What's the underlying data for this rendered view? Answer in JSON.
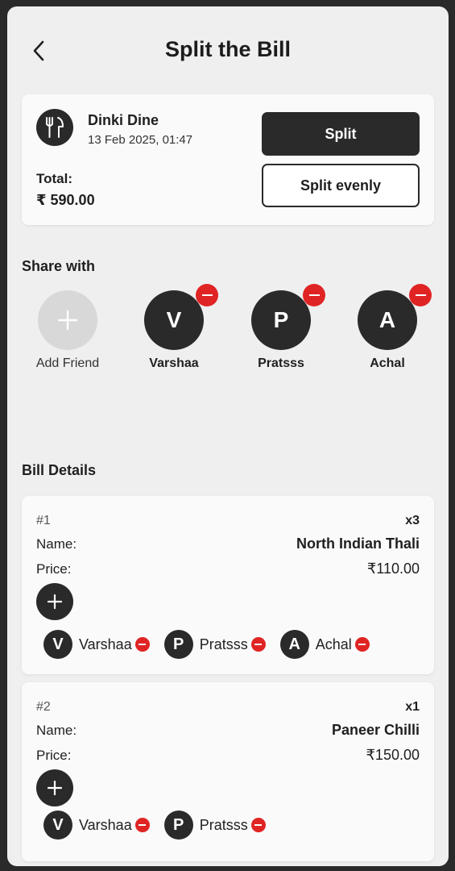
{
  "header": {
    "title": "Split the Bill"
  },
  "restaurant": {
    "name": "Dinki Dine",
    "date": "13 Feb 2025, 01:47",
    "total_label": "Total:",
    "total_value": "₹ 590.00",
    "icon": "fork-knife-icon"
  },
  "actions": {
    "split_label": "Split",
    "split_evenly_label": "Split evenly"
  },
  "share": {
    "label": "Share with",
    "add_label": "Add Friend",
    "friends": [
      {
        "initial": "V",
        "name": "Varshaa"
      },
      {
        "initial": "P",
        "name": "Pratsss"
      },
      {
        "initial": "A",
        "name": "Achal"
      }
    ]
  },
  "bill": {
    "label": "Bill Details",
    "name_label": "Name:",
    "price_label": "Price:",
    "items": [
      {
        "num": "#1",
        "qty": "x3",
        "name": "North Indian Thali",
        "price": "₹110.00",
        "people": [
          {
            "initial": "V",
            "name": "Varshaa"
          },
          {
            "initial": "P",
            "name": "Pratsss"
          },
          {
            "initial": "A",
            "name": "Achal"
          }
        ]
      },
      {
        "num": "#2",
        "qty": "x1",
        "name": "Paneer Chilli",
        "price": "₹150.00",
        "people": [
          {
            "initial": "V",
            "name": "Varshaa"
          },
          {
            "initial": "P",
            "name": "Pratsss"
          }
        ]
      }
    ]
  },
  "colors": {
    "dark": "#2a2a2a",
    "remove": "#e02424",
    "background": "#efefef"
  }
}
